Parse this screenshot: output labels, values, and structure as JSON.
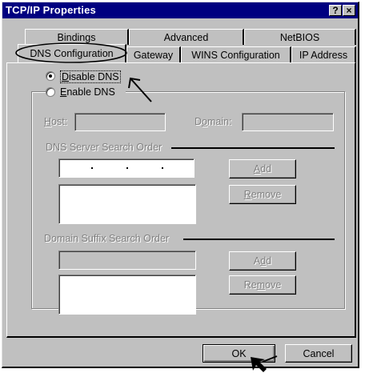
{
  "window": {
    "title": "TCP/IP Properties"
  },
  "titlebar_buttons": {
    "help": "?",
    "close": "×"
  },
  "tabs": {
    "row_back": [
      "Bindings",
      "Advanced",
      "NetBIOS"
    ],
    "row_front": [
      "DNS Configuration",
      "Gateway",
      "WINS Configuration",
      "IP Address"
    ]
  },
  "dns": {
    "disable_label_pre": "D",
    "disable_label_post": "isable DNS",
    "enable_label_pre": "E",
    "enable_label_post": "nable DNS",
    "selected": "Disable DNS",
    "host_label_pre": "H",
    "host_label_post": "ost:",
    "domain_label_pre": "D",
    "domain_label_mid": "o",
    "domain_label_post": "main:",
    "server_order_heading": "DNS Server Search Order",
    "suffix_order_heading": "Domain Suffix Search Order",
    "add_label_pre": "A",
    "add_label_post": "dd",
    "remove_label_pre": "R",
    "remove_label_post": "emove",
    "add2_label_pre": "A",
    "add2_label_mid": "d",
    "add2_label_post": "d",
    "remove2_label_pre": "Re",
    "remove2_label_mid": "m",
    "remove2_label_post": "ove"
  },
  "footer": {
    "ok": "OK",
    "cancel": "Cancel"
  },
  "colors": {
    "titlebar": "#000080",
    "face": "#c0c0c0",
    "annotation": "#000000"
  }
}
